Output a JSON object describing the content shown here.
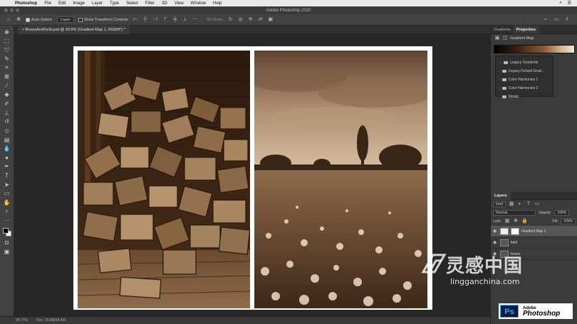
{
  "menubar": {
    "app": "Photoshop",
    "items": [
      "File",
      "Edit",
      "Image",
      "Layer",
      "Type",
      "Select",
      "Filter",
      "3D",
      "View",
      "Window",
      "Help"
    ]
  },
  "titlebar": {
    "title": "Adobe Photoshop 2020"
  },
  "options": {
    "auto_select_label": "Auto-Select:",
    "auto_select_value": "Layer",
    "show_transform_label": "Show Transform Controls",
    "mode_3d_label": "3D Mode:"
  },
  "document": {
    "tab_title": "BoxesAndField.psd @ 39.8% (Gradient Map 1, RGB/8*) *",
    "zoom": "39.77%",
    "doc_size": "Doc: 19.3M/34.4M"
  },
  "panels": {
    "tabs": [
      "Gradients",
      "Properties"
    ],
    "active_tab": "Properties",
    "properties_title": "Gradient Map",
    "presets": [
      {
        "label": "Legacy Gradients"
      },
      {
        "label": "Legacy Default Grad..."
      },
      {
        "label": "Color Harmonies 1"
      },
      {
        "label": "Color Harmonies 2"
      },
      {
        "label": "Metals"
      }
    ]
  },
  "layers": {
    "tab": "Layers",
    "filter_kind": "Kind",
    "blend_mode": "Normal",
    "opacity_label": "Opacity:",
    "opacity_value": "100%",
    "lock_label": "Lock:",
    "fill_label": "Fill:",
    "fill_value": "100%",
    "items": [
      {
        "name": "Gradient Map 1",
        "active": true
      },
      {
        "name": "field",
        "active": false
      },
      {
        "name": "boxes",
        "active": false
      }
    ]
  },
  "watermark": {
    "cn": "灵感中国",
    "en": "lingganchina.com"
  },
  "badge": {
    "ps": "Ps",
    "line1": "Adobe",
    "line2": "Photoshop"
  }
}
